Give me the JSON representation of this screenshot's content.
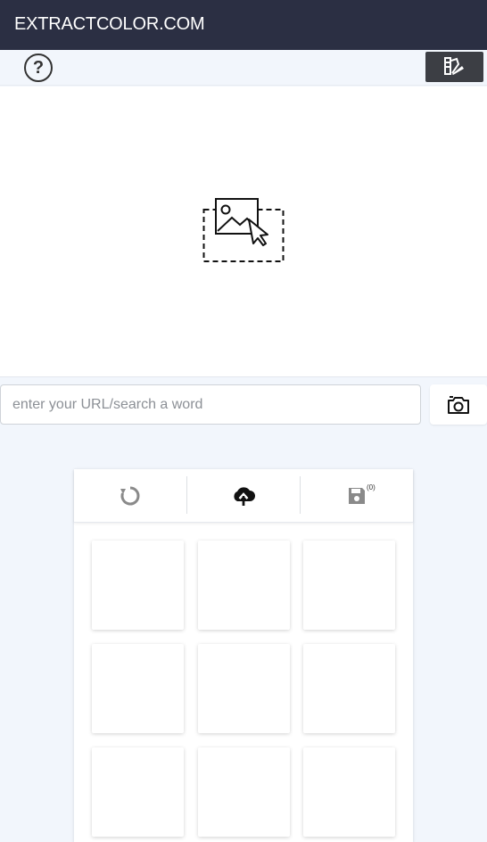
{
  "header": {
    "title": "EXTRACTCOLOR.COM"
  },
  "toolbar": {
    "help_icon_text": "?",
    "help_icon": "help-circle-icon",
    "palette_icon": "color-palette-icon"
  },
  "dropzone": {
    "icon": "image-upload-icon"
  },
  "search": {
    "placeholder": "enter your URL/search a word",
    "value": ""
  },
  "camera": {
    "icon": "camera-icon"
  },
  "panel": {
    "tabs": [
      {
        "name": "reset",
        "icon": "refresh-icon"
      },
      {
        "name": "upload",
        "icon": "cloud-upload-icon"
      },
      {
        "name": "saved",
        "icon": "save-icon",
        "count": "(0)"
      }
    ],
    "swatch_count": 9
  }
}
